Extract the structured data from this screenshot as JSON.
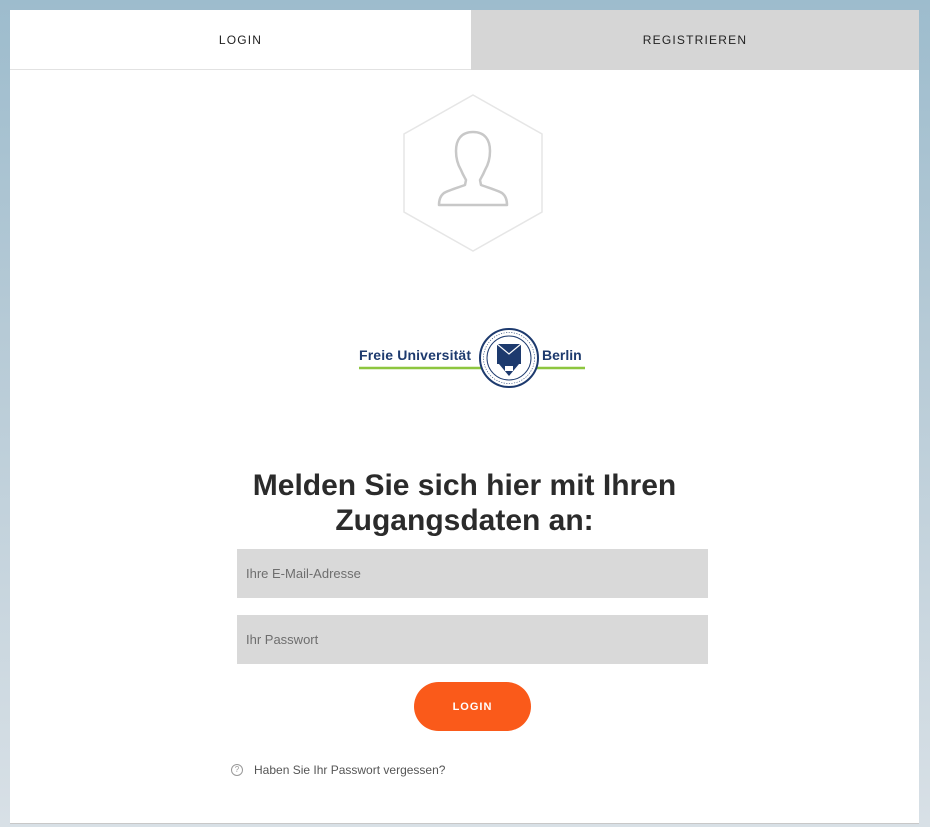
{
  "tabs": [
    {
      "label": "LOGIN",
      "active": true
    },
    {
      "label": "REGISTRIEREN",
      "active": false
    }
  ],
  "avatar": {
    "icon": "user-silhouette-icon"
  },
  "logo": {
    "left_text": "Freie Universität",
    "right_text": "Berlin",
    "seal_icon": "university-seal-icon",
    "text_color": "#1d3a6e",
    "underline_color": "#8dc63f"
  },
  "heading": {
    "line1": "Melden Sie sich hier mit Ihren",
    "line2": "Zugangsdaten an:"
  },
  "form": {
    "email_placeholder": "Ihre E-Mail-Adresse",
    "email_value": "",
    "password_placeholder": "Ihr Passwort",
    "password_value": "",
    "submit_label": "LOGIN",
    "submit_color": "#fa5a1a"
  },
  "forgot": {
    "icon": "question-circle-icon",
    "icon_glyph": "?",
    "label": "Haben Sie Ihr Passwort vergessen?"
  }
}
